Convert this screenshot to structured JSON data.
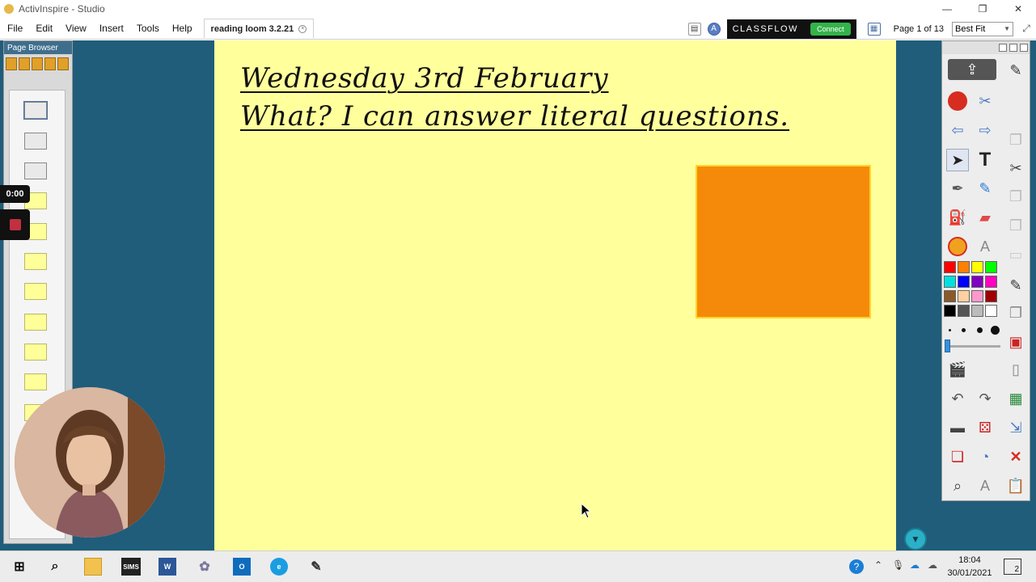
{
  "window": {
    "title": "ActivInspire - Studio",
    "minimize": "—",
    "restore": "❐",
    "close": "✕"
  },
  "menu": {
    "items": [
      "File",
      "Edit",
      "View",
      "Insert",
      "Tools",
      "Help"
    ]
  },
  "document_tab": {
    "label": "reading loom 3.2.21"
  },
  "classflow": {
    "brand": "CLASSFLOW",
    "connect": "Connect"
  },
  "pager": {
    "page_info": "Page 1 of 13",
    "zoom": "Best Fit"
  },
  "page_browser": {
    "title": "Page Browser"
  },
  "recording": {
    "timer": "0:00"
  },
  "flipchart": {
    "line1": "Wednesday 3rd February",
    "line2": "What? I can answer literal questions.",
    "shape_color": "#f58a0a",
    "background": "#ffff9c"
  },
  "toolbox": {
    "palette": [
      "#ff0000",
      "#ff8000",
      "#ffff00",
      "#00ff00",
      "#00e0e0",
      "#0000ff",
      "#8000c0",
      "#ff00c0",
      "#8b5a2b",
      "#ffd0a0",
      "#ff99cc",
      "#a00000",
      "#000000",
      "#555555",
      "#bbbbbb",
      "#ffffff"
    ]
  },
  "taskbar": {
    "time": "18:04",
    "date": "30/01/2021",
    "notifications": "2",
    "sims": "SIMS"
  }
}
